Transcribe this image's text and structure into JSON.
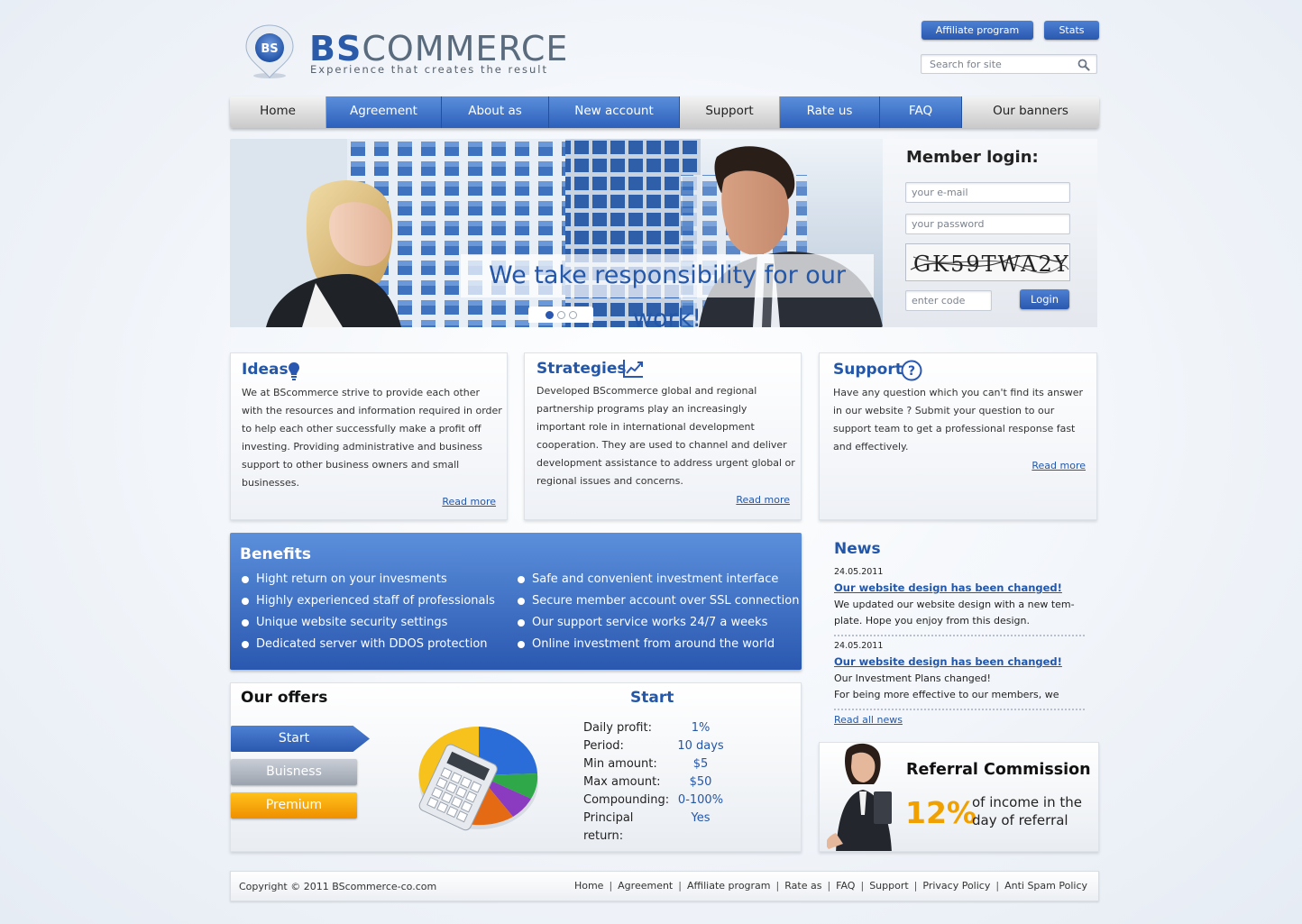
{
  "header": {
    "logo_short": "BS",
    "logo_bold": "BS",
    "logo_rest": "COMMERCE",
    "tagline": "Experience that creates the result",
    "affiliate_label": "Affiliate program",
    "stats_label": "Stats",
    "search_placeholder": "Search for site"
  },
  "nav": {
    "items": [
      {
        "label": "Home"
      },
      {
        "label": "Agreement"
      },
      {
        "label": "About as"
      },
      {
        "label": "New account"
      },
      {
        "label": "Support"
      },
      {
        "label": "Rate us"
      },
      {
        "label": "FAQ"
      },
      {
        "label": "Our banners"
      }
    ]
  },
  "hero": {
    "caption": "We take responsibility for our work!"
  },
  "login": {
    "title": "Member login:",
    "email_placeholder": "your e-mail",
    "password_placeholder": "your password",
    "captcha_text": "GK59TWA2Y",
    "code_placeholder": "enter code",
    "button_label": "Login"
  },
  "boxes": {
    "ideas": {
      "title": "Ideas",
      "text": "We at BScommerce strive to provide each other with the resources and information required in order to help each other successfully make a profit off investing. Providing administrative and business support to other business owners and small businesses.",
      "read_more": "Read more"
    },
    "strategies": {
      "title": "Strategies",
      "text": "Developed BScommerce global and regional partnership programs play an increasingly important role in international development cooperation. They are used to channel and deliver development assistance to address urgent global or regional issues and concerns.",
      "read_more": "Read more"
    },
    "support": {
      "title": "Support",
      "text": "Have any question which you can't find its answer in our website ? Submit your question to our support team to get a professional response fast and effectively.",
      "read_more": "Read more"
    }
  },
  "benefits": {
    "title": "Benefits",
    "left": [
      "Hight return on your invesments",
      "Highly experienced staff of professionals",
      "Unique website security settings",
      "Dedicated server with DDOS protection"
    ],
    "right": [
      "Safe and convenient investment interface",
      "Secure member account over SSL connection",
      "Our support service works 24/7 a weeks",
      "Online investment from around the world"
    ]
  },
  "offers": {
    "title": "Our offers",
    "tabs": [
      "Start",
      "Buisness",
      "Premium"
    ],
    "plan_title": "Start",
    "rows": [
      {
        "k": "Daily profit:",
        "v": "1%"
      },
      {
        "k": "Period:",
        "v": "10 days"
      },
      {
        "k": "Min amount:",
        "v": "$5"
      },
      {
        "k": "Max amount:",
        "v": "$50"
      },
      {
        "k": "Compounding:",
        "v": "0-100%"
      },
      {
        "k": "Principal return:",
        "v": "Yes"
      }
    ]
  },
  "news": {
    "title": "News",
    "items": [
      {
        "date": "24.05.2011",
        "headline": "Our website design has been changed!",
        "line1": "We updated our website design with a new tem-",
        "line2": "plate. Hope you enjoy from this design."
      },
      {
        "date": "24.05.2011",
        "headline": "Our website design has been changed!",
        "line1": "Our Investment Plans changed!",
        "line2": "For being more effective to our members, we"
      }
    ],
    "read_all": "Read all news"
  },
  "referral": {
    "title": "Referral Commission",
    "percent": "12%",
    "line1": "of income in the",
    "line2": "day of referral"
  },
  "footer": {
    "copyright": "Copyright © 2011 BScommerce-co.com",
    "links": [
      "Home",
      "Agreement",
      "Affiliate program",
      "Rate as",
      "FAQ",
      "Support",
      "Privacy Policy",
      "Anti Spam Policy"
    ]
  },
  "colors": {
    "brand_blue": "#2a58b0",
    "accent_orange": "#f0a000",
    "link_blue": "#2457a8"
  }
}
